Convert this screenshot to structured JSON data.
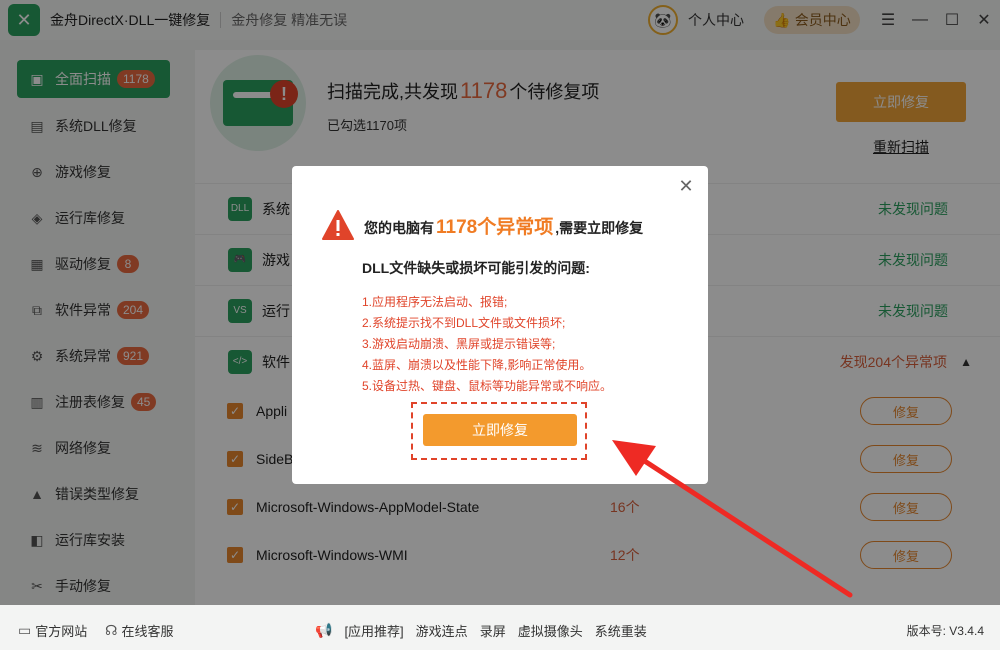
{
  "app": {
    "title": "金舟DirectX·DLL一键修复",
    "slogan": "金舟修复 精准无误",
    "user_center": "个人中心",
    "vip_center": "会员中心"
  },
  "sidebar": {
    "items": [
      {
        "label": "全面扫描",
        "badge": "1178",
        "icon": "scan-icon"
      },
      {
        "label": "系统DLL修复",
        "badge": "",
        "icon": "dll-icon"
      },
      {
        "label": "游戏修复",
        "badge": "",
        "icon": "gamepad-icon"
      },
      {
        "label": "运行库修复",
        "badge": "",
        "icon": "runtime-icon"
      },
      {
        "label": "驱动修复",
        "badge": "8",
        "icon": "driver-icon"
      },
      {
        "label": "软件异常",
        "badge": "204",
        "icon": "code-icon"
      },
      {
        "label": "系统异常",
        "badge": "921",
        "icon": "gear-icon"
      },
      {
        "label": "注册表修复",
        "badge": "45",
        "icon": "registry-icon"
      },
      {
        "label": "网络修复",
        "badge": "",
        "icon": "wifi-icon"
      },
      {
        "label": "错误类型修复",
        "badge": "",
        "icon": "warning-icon"
      },
      {
        "label": "运行库安装",
        "badge": "",
        "icon": "install-icon"
      },
      {
        "label": "手动修复",
        "badge": "",
        "icon": "wrench-icon"
      }
    ]
  },
  "scan": {
    "title_prefix": "扫描完成,共发现",
    "count": "1178",
    "title_suffix": "个待修复项",
    "selected": "已勾选1170项",
    "repair_now": "立即修复",
    "rescan": "重新扫描"
  },
  "categories": [
    {
      "name": "系统",
      "status": "未发现问题",
      "icon": "DLL"
    },
    {
      "name": "游戏",
      "status": "未发现问题",
      "icon": "🎮"
    },
    {
      "name": "运行",
      "status": "未发现问题",
      "icon": "VS"
    },
    {
      "name": "软件",
      "status": "发现204个异常项",
      "icon": "</>"
    }
  ],
  "items": [
    {
      "name": "Appli",
      "count": "",
      "fix": "修复"
    },
    {
      "name": "SideB",
      "count": "",
      "fix": "修复"
    },
    {
      "name": "Microsoft-Windows-AppModel-State",
      "count": "16个",
      "fix": "修复"
    },
    {
      "name": "Microsoft-Windows-WMI",
      "count": "12个",
      "fix": "修复"
    }
  ],
  "dialog": {
    "head_prefix": "您的电脑有",
    "head_count": "1178个异常项",
    "head_suffix": ",需要立即修复",
    "subtitle": "DLL文件缺失或损坏可能引发的问题:",
    "problems": [
      "1.应用程序无法启动、报错;",
      "2.系统提示找不到DLL文件或文件损坏;",
      "3.游戏启动崩溃、黑屏或提示错误等;",
      "4.蓝屏、崩溃以及性能下降,影响正常使用。",
      "5.设备过热、键盘、鼠标等功能异常或不响应。"
    ],
    "repair_button": "立即修复"
  },
  "footer": {
    "official_site": "官方网站",
    "online_service": "在线客服",
    "links": [
      "[应用推荐]",
      "游戏连点",
      "录屏",
      "虚拟摄像头",
      "系统重装"
    ],
    "version": "版本号: V3.4.4"
  },
  "colors": {
    "brand_green": "#2aa05f",
    "accent_orange": "#f39a2d",
    "warning_red": "#e0442a"
  }
}
